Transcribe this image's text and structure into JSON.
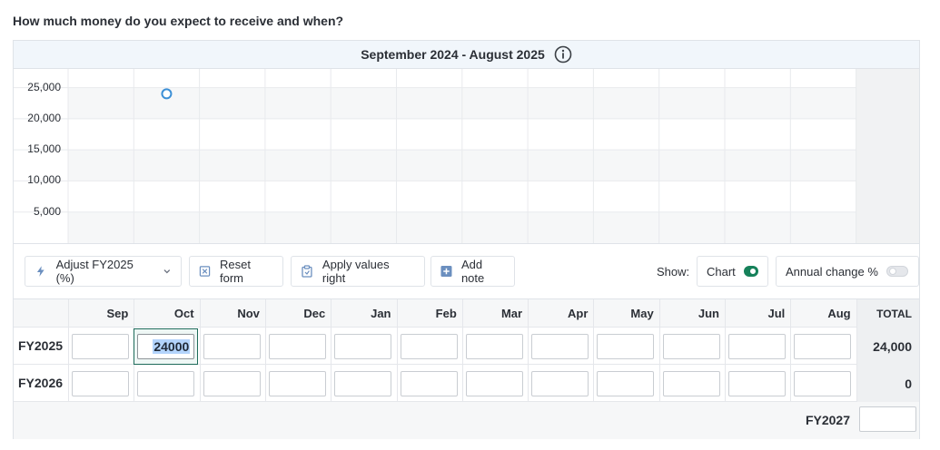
{
  "question": "How much money do you expect to receive and when?",
  "period": {
    "label": "September 2024 - August 2025",
    "info_icon": "info-icon"
  },
  "chart_data": {
    "type": "line",
    "categories": [
      "Sep",
      "Oct",
      "Nov",
      "Dec",
      "Jan",
      "Feb",
      "Mar",
      "Apr",
      "May",
      "Jun",
      "Jul",
      "Aug"
    ],
    "series": [
      {
        "values": [
          null,
          24000,
          null,
          null,
          null,
          null,
          null,
          null,
          null,
          null,
          null,
          null
        ]
      }
    ],
    "y_ticks": [
      "25,000",
      "20,000",
      "15,000",
      "10,000",
      "5,000"
    ],
    "ylim": [
      0,
      28000
    ],
    "grid": true,
    "title": "",
    "xlabel": "",
    "ylabel": ""
  },
  "toolbar": {
    "adjust_label": "Adjust FY2025 (%)",
    "reset_label": "Reset form",
    "apply_label": "Apply values right",
    "note_label": "Add note",
    "show_label": "Show:",
    "chart_toggle_label": "Chart",
    "chart_toggle_on": true,
    "annual_toggle_label": "Annual change %",
    "annual_toggle_on": false
  },
  "table": {
    "months": [
      "Sep",
      "Oct",
      "Nov",
      "Dec",
      "Jan",
      "Feb",
      "Mar",
      "Apr",
      "May",
      "Jun",
      "Jul",
      "Aug"
    ],
    "total_header": "TOTAL",
    "rows": [
      {
        "label": "FY2025",
        "values": [
          "",
          "24000",
          "",
          "",
          "",
          "",
          "",
          "",
          "",
          "",
          "",
          ""
        ],
        "total": "24,000"
      },
      {
        "label": "FY2026",
        "values": [
          "",
          "",
          "",
          "",
          "",
          "",
          "",
          "",
          "",
          "",
          "",
          ""
        ],
        "total": "0"
      }
    ],
    "fy2027_label": "FY2027"
  },
  "colors": {
    "accent": "#16815a",
    "point": "#3b8fd6",
    "header_bg": "#f1f6fb"
  }
}
